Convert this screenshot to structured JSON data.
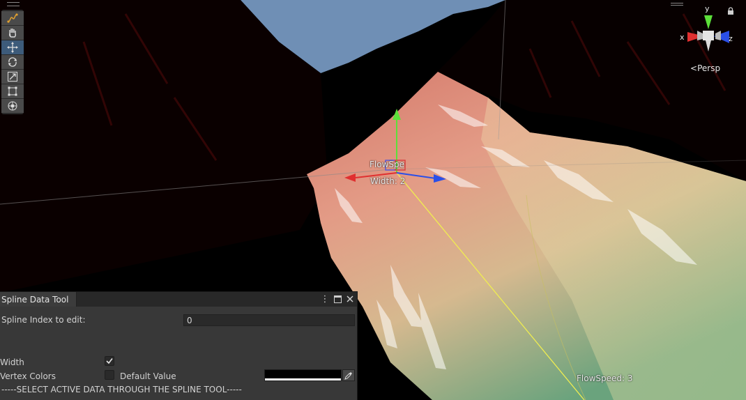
{
  "viewport": {
    "projection_label": "Persp",
    "gizmo_axes": {
      "x": "x",
      "y": "y",
      "z": "z"
    },
    "handle_labels": {
      "flow_speed_partial": "FlowSpe",
      "width": "Width: 2"
    },
    "flow_speed_label": "FlowSpeed: 3"
  },
  "toolbar": {
    "tools": [
      {
        "name": "spline-tool-icon",
        "active": false
      },
      {
        "name": "hand-tool-icon",
        "active": false
      },
      {
        "name": "move-tool-icon",
        "active": true
      },
      {
        "name": "rotate-tool-icon",
        "active": false
      },
      {
        "name": "scale-tool-icon",
        "active": false
      },
      {
        "name": "rect-tool-icon",
        "active": false
      },
      {
        "name": "transform-tool-icon",
        "active": false
      }
    ]
  },
  "panel": {
    "tab_title": "Spline Data Tool",
    "spline_index_label": "Spline Index to edit:",
    "spline_index_value": "0",
    "width_label": "Width",
    "width_checked": true,
    "vertex_colors_label": "Vertex Colors",
    "vertex_colors_checked": false,
    "default_value_label": "Default Value",
    "default_color": "#000000",
    "hint": "-----SELECT ACTIVE DATA THROUGH THE SPLINE TOOL-----"
  },
  "colors": {
    "axis_x": "#e03030",
    "axis_y": "#5ce03a",
    "axis_z": "#2a4fe8",
    "spline_line": "#f0ee50",
    "sky": "#6f8fb5"
  }
}
